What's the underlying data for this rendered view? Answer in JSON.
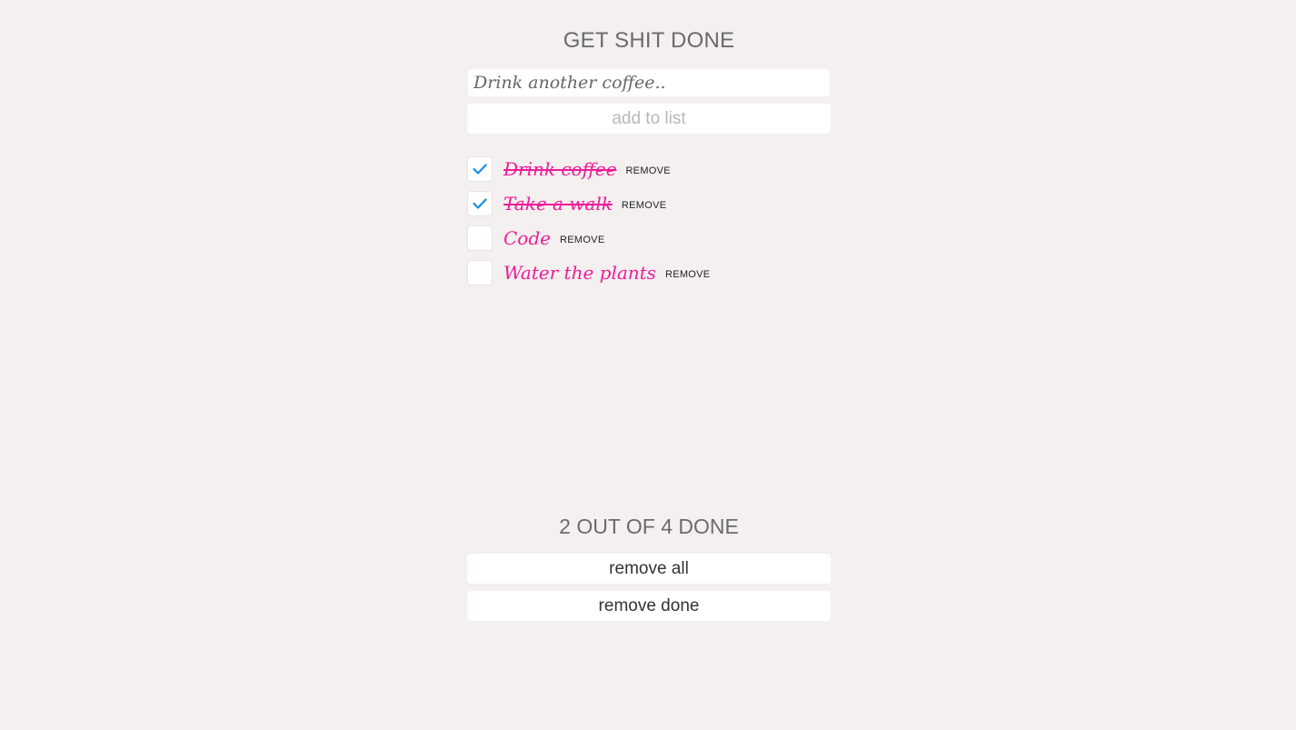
{
  "header": {
    "title": "GET SHIT DONE"
  },
  "new_item": {
    "placeholder": "Drink another coffee..",
    "value": ""
  },
  "add_button": {
    "label": "add to list",
    "enabled": false
  },
  "todos": [
    {
      "text": "Drink coffee",
      "done": true,
      "remove_label": "REMOVE"
    },
    {
      "text": "Take a walk",
      "done": true,
      "remove_label": "REMOVE"
    },
    {
      "text": "Code",
      "done": false,
      "remove_label": "REMOVE"
    },
    {
      "text": "Water the plants",
      "done": false,
      "remove_label": "REMOVE"
    }
  ],
  "footer": {
    "summary": "2 OUT OF 4 DONE",
    "remove_all_label": "remove all",
    "remove_done_label": "remove done"
  },
  "colors": {
    "background": "#f3f0ef",
    "todo_text": "#ee1c9a",
    "check": "#1a8fe3"
  },
  "icons": {
    "checked": "checkmark-icon"
  }
}
